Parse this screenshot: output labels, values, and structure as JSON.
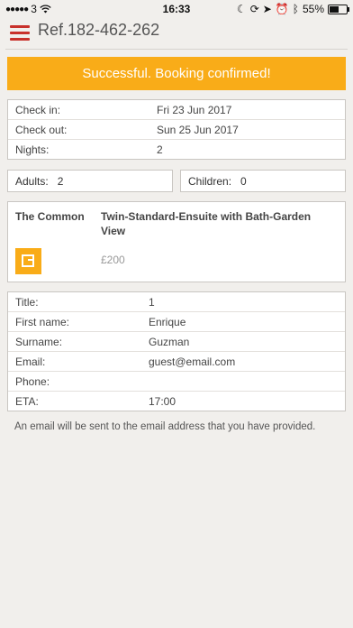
{
  "status_bar": {
    "carrier": "3",
    "time": "16:33",
    "battery": "55%",
    "battery_level": 0.55
  },
  "header": {
    "title": "Ref.182-462-262"
  },
  "banner": {
    "text": "Successful. Booking confirmed!"
  },
  "dates": [
    {
      "label": "Check in:",
      "value": "Fri 23 Jun 2017"
    },
    {
      "label": "Check out:",
      "value": "Sun 25 Jun 2017"
    },
    {
      "label": "Nights:",
      "value": "2"
    }
  ],
  "pax": {
    "adults_label": "Adults:",
    "adults_value": "2",
    "children_label": "Children:",
    "children_value": "0"
  },
  "room": {
    "property": "The Common",
    "name": "Twin-Standard-Ensuite with Bath-Garden View",
    "price": "£200"
  },
  "guest": [
    {
      "label": "Title:",
      "value": "1"
    },
    {
      "label": "First name:",
      "value": "Enrique"
    },
    {
      "label": "Surname:",
      "value": "Guzman"
    },
    {
      "label": "Email:",
      "value": "guest@email.com"
    },
    {
      "label": "Phone:",
      "value": ""
    },
    {
      "label": "ETA:",
      "value": "17:00"
    }
  ],
  "note": "An email will be sent to the email address that you have provided.",
  "colors": {
    "accent": "#f9ac18",
    "menu": "#c8312b",
    "background": "#f1efec"
  }
}
